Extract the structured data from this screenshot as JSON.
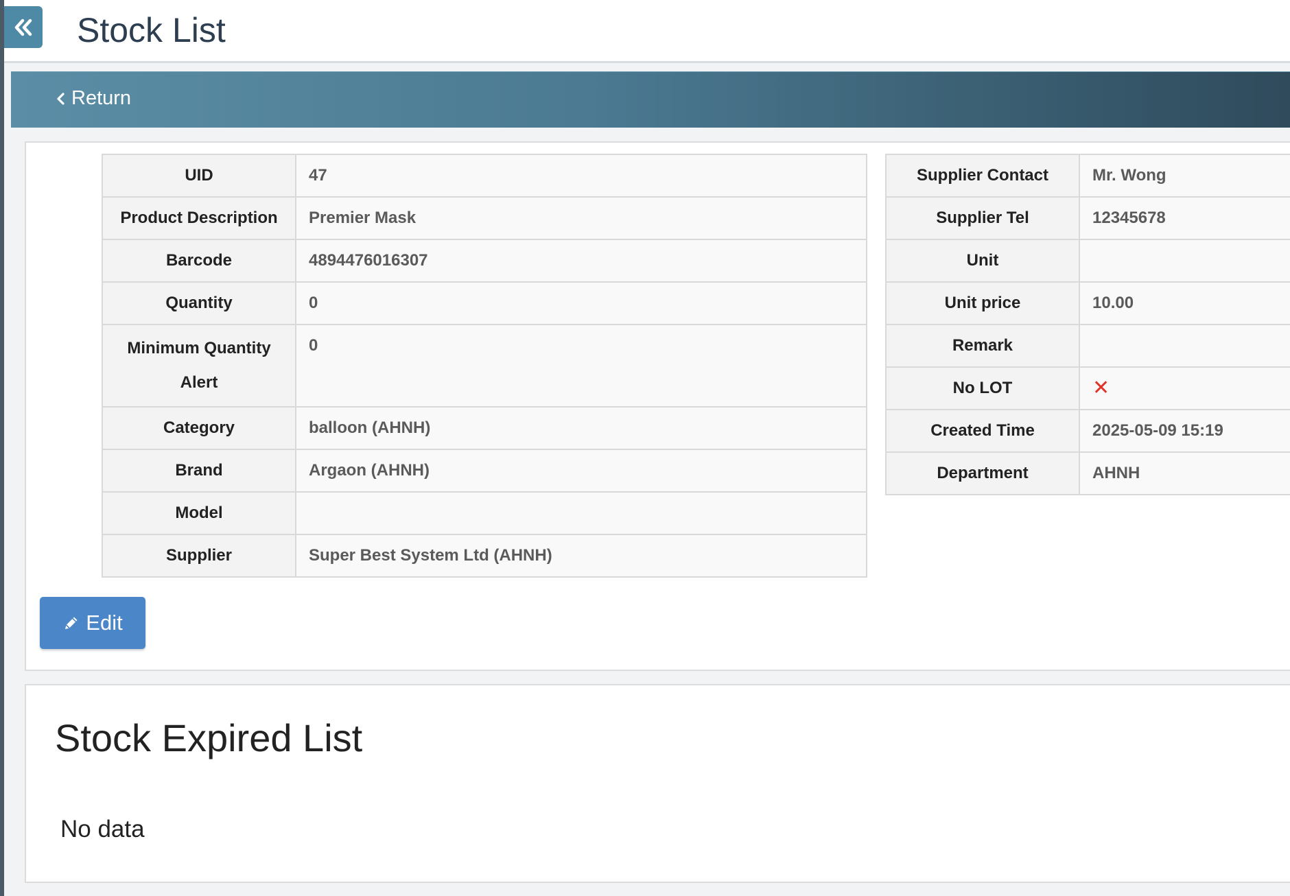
{
  "header": {
    "title": "Stock List",
    "collapse_icon": "double-chevron-left-icon"
  },
  "nav": {
    "return_label": "Return"
  },
  "detail": {
    "left": [
      {
        "label": "UID",
        "value": "47"
      },
      {
        "label": "Product Description",
        "value": "Premier Mask"
      },
      {
        "label": "Barcode",
        "value": "4894476016307"
      },
      {
        "label": "Quantity",
        "value": "0"
      },
      {
        "label": "Minimum Quantity Alert",
        "value": "0"
      },
      {
        "label": "Category",
        "value": "balloon (AHNH)"
      },
      {
        "label": "Brand",
        "value": "Argaon (AHNH)"
      },
      {
        "label": "Model",
        "value": ""
      },
      {
        "label": "Supplier",
        "value": "Super Best System Ltd (AHNH)"
      }
    ],
    "right": [
      {
        "label": "Supplier Contact",
        "value": "Mr. Wong"
      },
      {
        "label": "Supplier Tel",
        "value": "12345678"
      },
      {
        "label": "Unit",
        "value": ""
      },
      {
        "label": "Unit price",
        "value": "10.00"
      },
      {
        "label": "Remark",
        "value": ""
      },
      {
        "label": "No LOT",
        "value": "✕"
      },
      {
        "label": "Created Time",
        "value": "2025-05-09 15:19"
      },
      {
        "label": "Department",
        "value": "AHNH"
      }
    ],
    "no_lot_icon": "red-x-icon",
    "edit_label": "Edit"
  },
  "expired": {
    "title": "Stock Expired List",
    "empty_text": "No data"
  },
  "colors": {
    "accent": "#4a86c8",
    "header_bar": "#4b7a92",
    "collapse_button": "#4e8aa6",
    "x_mark": "#e03226"
  }
}
